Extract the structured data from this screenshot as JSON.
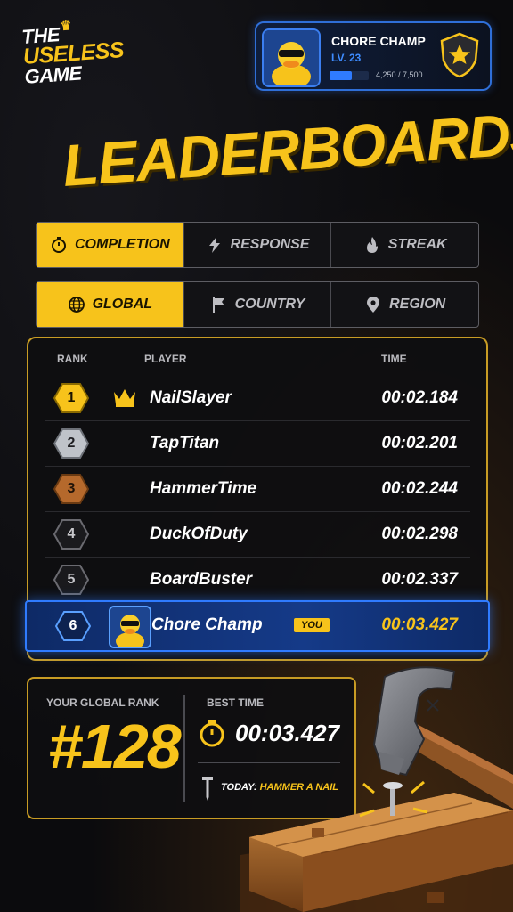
{
  "logo": {
    "line1": "THE",
    "line2": "USELESS",
    "line3": "GAME"
  },
  "profile": {
    "name": "CHORE CHAMP",
    "level": "LV. 23",
    "xp_text": "4,250 / 7,500",
    "xp_fraction": 0.567
  },
  "title": "LEADERBOARDS",
  "mode_tabs": [
    {
      "label": "COMPLETION",
      "icon": "stopwatch-icon",
      "active": true
    },
    {
      "label": "RESPONSE",
      "icon": "lightning-icon",
      "active": false
    },
    {
      "label": "STREAK",
      "icon": "flame-icon",
      "active": false
    }
  ],
  "scope_tabs": [
    {
      "label": "GLOBAL",
      "icon": "globe-icon",
      "active": true
    },
    {
      "label": "COUNTRY",
      "icon": "flag-icon",
      "active": false
    },
    {
      "label": "REGION",
      "icon": "location-pin-icon",
      "active": false
    }
  ],
  "table": {
    "headers": {
      "rank": "RANK",
      "player": "PLAYER",
      "time": "TIME"
    },
    "rows": [
      {
        "rank": "1",
        "player": "NailSlayer",
        "time": "00:02.184",
        "medal": "gold"
      },
      {
        "rank": "2",
        "player": "TapTitan",
        "time": "00:02.201",
        "medal": "silver"
      },
      {
        "rank": "3",
        "player": "HammerTime",
        "time": "00:02.244",
        "medal": "bronze"
      },
      {
        "rank": "4",
        "player": "DuckOfDuty",
        "time": "00:02.298",
        "medal": "none"
      },
      {
        "rank": "5",
        "player": "BoardBuster",
        "time": "00:02.337",
        "medal": "none"
      }
    ],
    "you_row": {
      "rank": "6",
      "player": "Chore Champ",
      "tag": "YOU",
      "time": "00:03.427"
    }
  },
  "summary": {
    "rank_label": "YOUR GLOBAL RANK",
    "rank_value": "#128",
    "best_label": "BEST TIME",
    "best_value": "00:03.427",
    "today_prefix": "TODAY:",
    "today_task": "HAMMER A NAIL"
  },
  "colors": {
    "accent": "#f7c31b",
    "blue": "#2f7bff",
    "gold": "#f7c31b",
    "silver": "#bfc3c9",
    "bronze": "#b5692c"
  }
}
